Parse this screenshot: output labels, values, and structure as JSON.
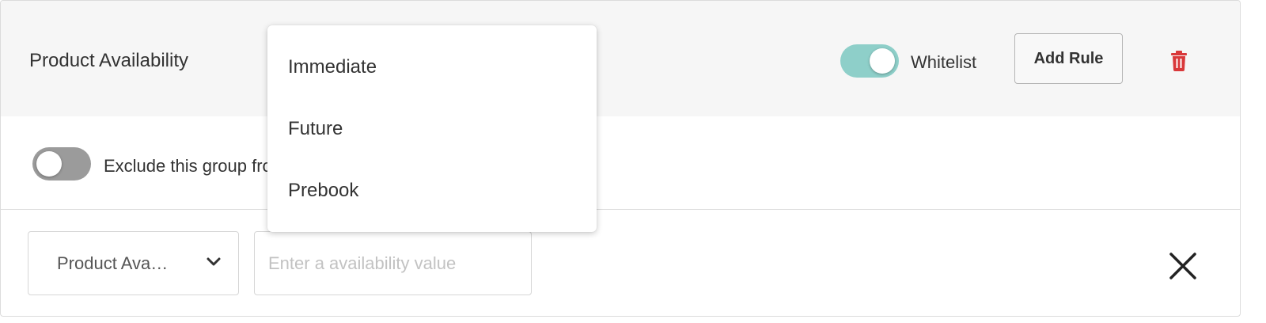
{
  "group": {
    "title": "Product Availability",
    "whitelist_label": "Whitelist",
    "whitelist_on": true,
    "add_rule_label": "Add Rule"
  },
  "exclude": {
    "label": "Exclude this group from",
    "enabled": false
  },
  "rule": {
    "field_value": "Product Ava…",
    "value_placeholder": "Enter a availability value"
  },
  "dropdown": {
    "options": [
      "Immediate",
      "Future",
      "Prebook"
    ]
  },
  "colors": {
    "toggle_on": "#8ecfc9",
    "toggle_off": "#9b9b9b",
    "delete": "#d9383a"
  },
  "icons": {
    "delete": "trash-icon",
    "chevron": "chevron-down-icon",
    "close": "close-icon"
  }
}
